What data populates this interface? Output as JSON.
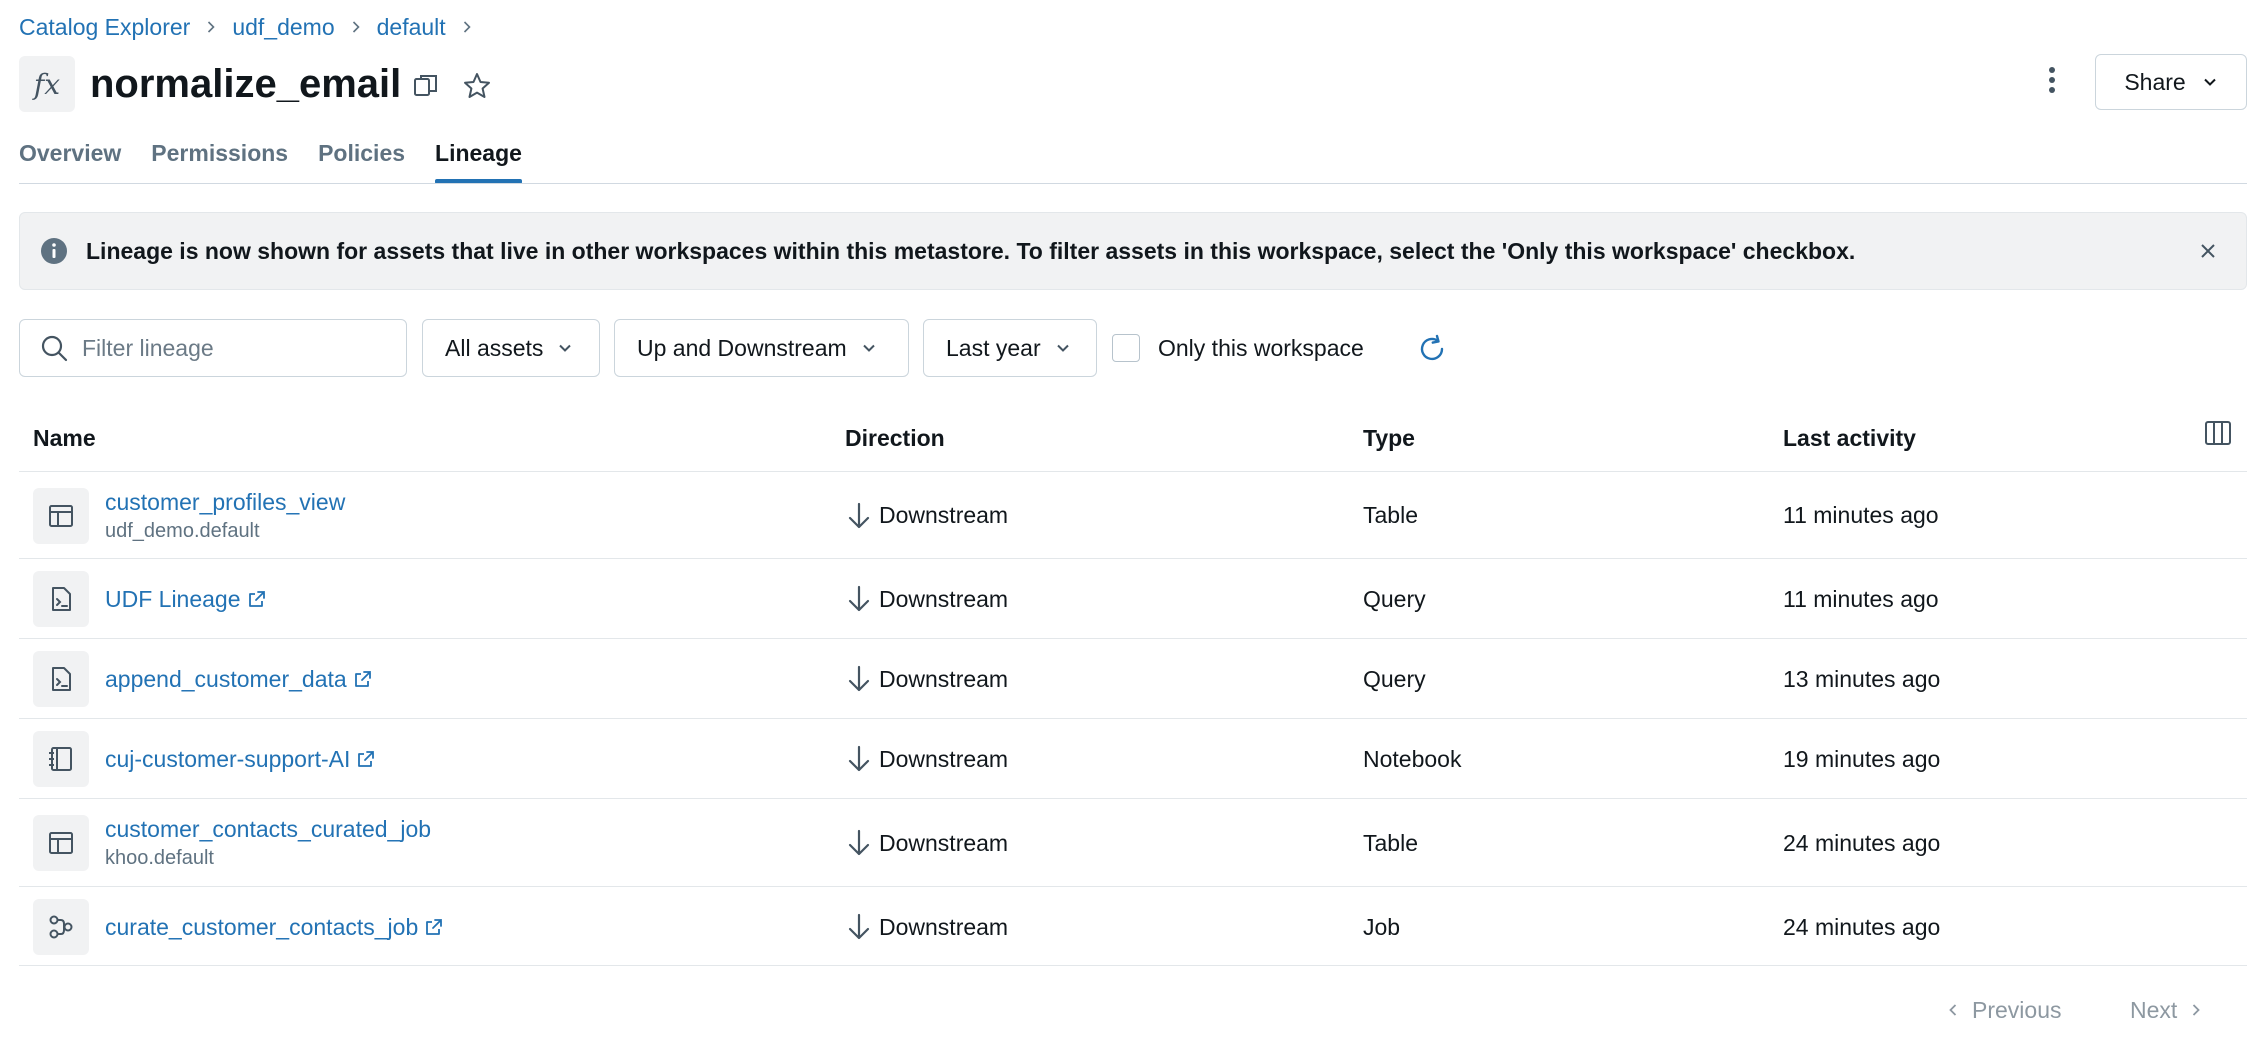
{
  "breadcrumb": {
    "items": [
      "Catalog Explorer",
      "udf_demo",
      "default"
    ]
  },
  "header": {
    "type_icon_glyph": "fx",
    "title": "normalize_email",
    "share_label": "Share"
  },
  "tabs": [
    {
      "label": "Overview",
      "active": false
    },
    {
      "label": "Permissions",
      "active": false
    },
    {
      "label": "Policies",
      "active": false
    },
    {
      "label": "Lineage",
      "active": true
    }
  ],
  "banner": {
    "text": "Lineage is now shown for assets that live in other workspaces within this metastore. To filter assets in this workspace, select the 'Only this workspace' checkbox."
  },
  "filters": {
    "search_placeholder": "Filter lineage",
    "assets": "All assets",
    "direction": "Up and Downstream",
    "time_range": "Last year",
    "only_workspace_label": "Only this workspace",
    "only_workspace_checked": false
  },
  "table": {
    "columns": [
      "Name",
      "Direction",
      "Type",
      "Last activity"
    ],
    "rows": [
      {
        "icon": "table-icon",
        "name": "customer_profiles_view",
        "sub": "udf_demo.default",
        "external": false,
        "direction": "Downstream",
        "type": "Table",
        "last_activity": "11 minutes ago"
      },
      {
        "icon": "query-icon",
        "name": "UDF Lineage",
        "sub": "",
        "external": true,
        "direction": "Downstream",
        "type": "Query",
        "last_activity": "11 minutes ago"
      },
      {
        "icon": "query-icon",
        "name": "append_customer_data",
        "sub": "",
        "external": true,
        "direction": "Downstream",
        "type": "Query",
        "last_activity": "13 minutes ago"
      },
      {
        "icon": "notebook-icon",
        "name": "cuj-customer-support-AI",
        "sub": "",
        "external": true,
        "direction": "Downstream",
        "type": "Notebook",
        "last_activity": "19 minutes ago"
      },
      {
        "icon": "table-icon",
        "name": "customer_contacts_curated_job",
        "sub": "khoo.default",
        "external": false,
        "direction": "Downstream",
        "type": "Table",
        "last_activity": "24 minutes ago"
      },
      {
        "icon": "job-icon",
        "name": "curate_customer_contacts_job",
        "sub": "",
        "external": true,
        "direction": "Downstream",
        "type": "Job",
        "last_activity": "24 minutes ago"
      }
    ]
  },
  "pagination": {
    "previous_label": "Previous",
    "next_label": "Next"
  },
  "colors": {
    "link": "#2272b4",
    "text": "#11171c",
    "muted": "#5f7281",
    "banner_bg": "#f1f2f3",
    "border": "#cbd5dc"
  }
}
